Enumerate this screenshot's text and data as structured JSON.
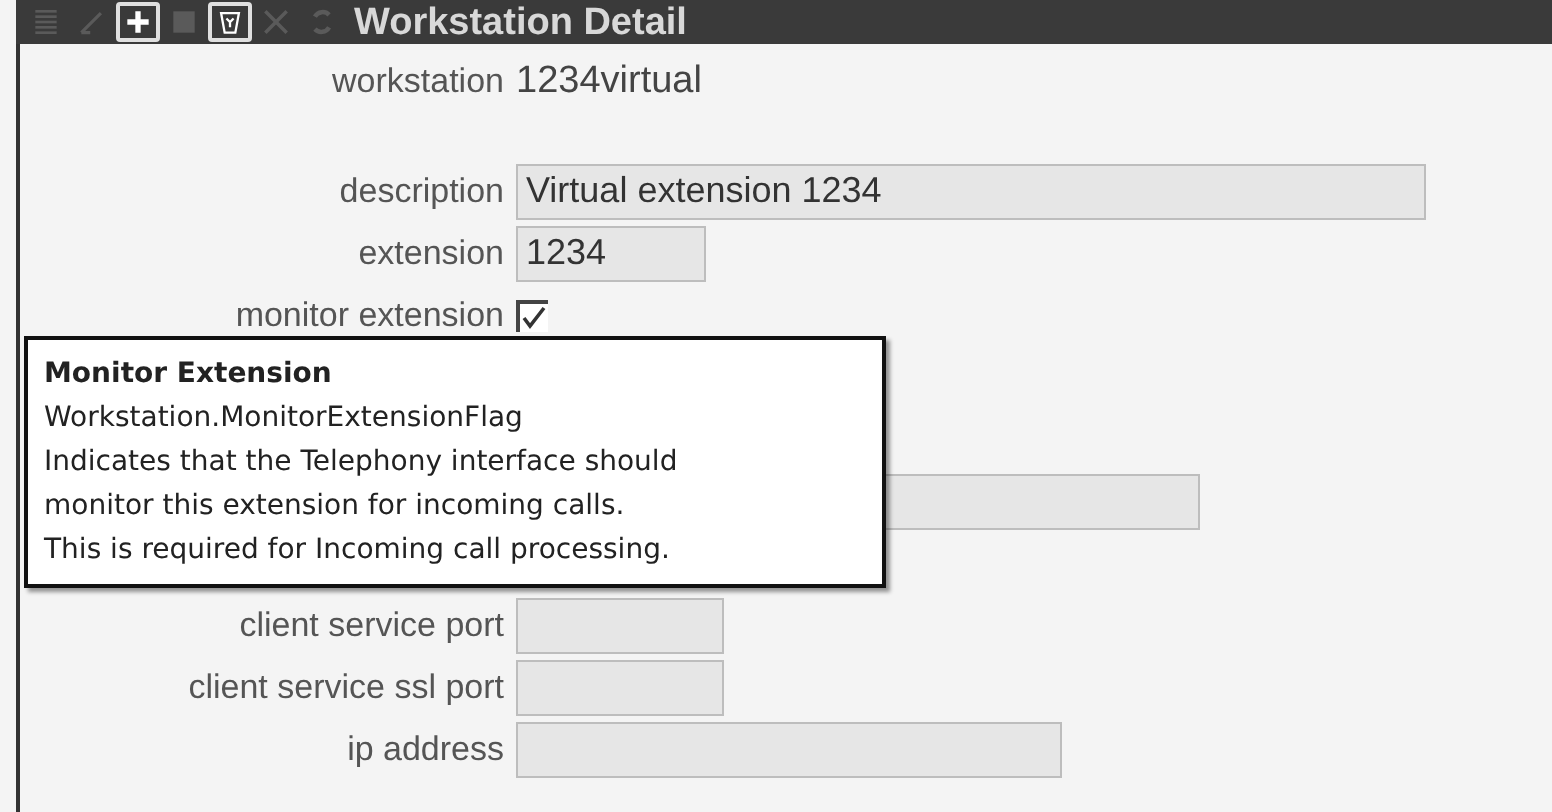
{
  "toolbar": [
    {
      "kind": "list",
      "disabled": true
    },
    {
      "kind": "edit",
      "disabled": true
    },
    {
      "kind": "add",
      "disabled": false
    },
    {
      "kind": "save",
      "disabled": true
    },
    {
      "kind": "delete",
      "disabled": false
    },
    {
      "kind": "cancel",
      "disabled": true
    },
    {
      "kind": "refresh",
      "disabled": true
    }
  ],
  "title": "Workstation Detail",
  "fields": [
    {
      "kind": "text",
      "label": "workstation",
      "value": "1234virtual"
    },
    {
      "kind": "input",
      "label": "description",
      "value": "Virtual extension 1234"
    },
    {
      "kind": "input",
      "label": "extension",
      "value": "1234"
    },
    {
      "kind": "checkbox",
      "label": "monitor extension",
      "checked": true
    },
    {
      "kind": "hidden"
    },
    {
      "kind": "hidden"
    },
    {
      "kind": "input"
    },
    {
      "kind": "hidden"
    },
    {
      "kind": "input",
      "label": "client service port"
    },
    {
      "kind": "input",
      "label": "client service ssl port"
    },
    {
      "kind": "input",
      "label": "ip address"
    }
  ],
  "tooltip": {
    "title": "Monitor Extension",
    "lines": [
      "Workstation.MonitorExtensionFlag",
      "Indicates that the Telephony interface should",
      "monitor this extension for incoming calls.",
      "This is required for Incoming call processing."
    ]
  }
}
